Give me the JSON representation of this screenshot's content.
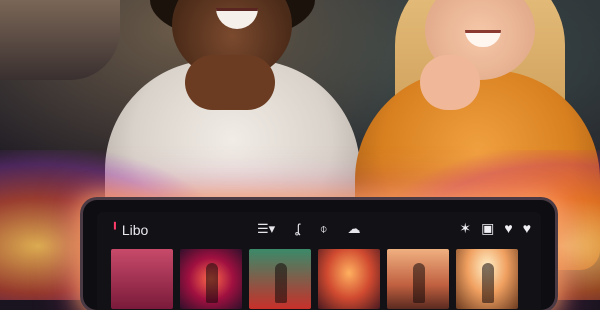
{
  "app": {
    "logo_text": "Libo"
  },
  "nav": {
    "items": [
      {
        "icon": "menu-icon",
        "glyph": "☰▾"
      },
      {
        "icon": "person-icon",
        "glyph": "ʆ"
      },
      {
        "icon": "speech-bubble-icon",
        "glyph": "⌽"
      },
      {
        "icon": "cloud-icon",
        "glyph": "☁"
      }
    ]
  },
  "actions": {
    "items": [
      {
        "icon": "star-icon",
        "glyph": "✶"
      },
      {
        "icon": "calendar-icon",
        "glyph": "▣"
      },
      {
        "icon": "heart-icon",
        "glyph": "♥"
      },
      {
        "icon": "heart-filled-icon",
        "glyph": "♥"
      }
    ]
  },
  "colors": {
    "brand": "#ff3c6a",
    "glow_warm": "#ffb45a",
    "glow_pink": "#dc50a0"
  }
}
